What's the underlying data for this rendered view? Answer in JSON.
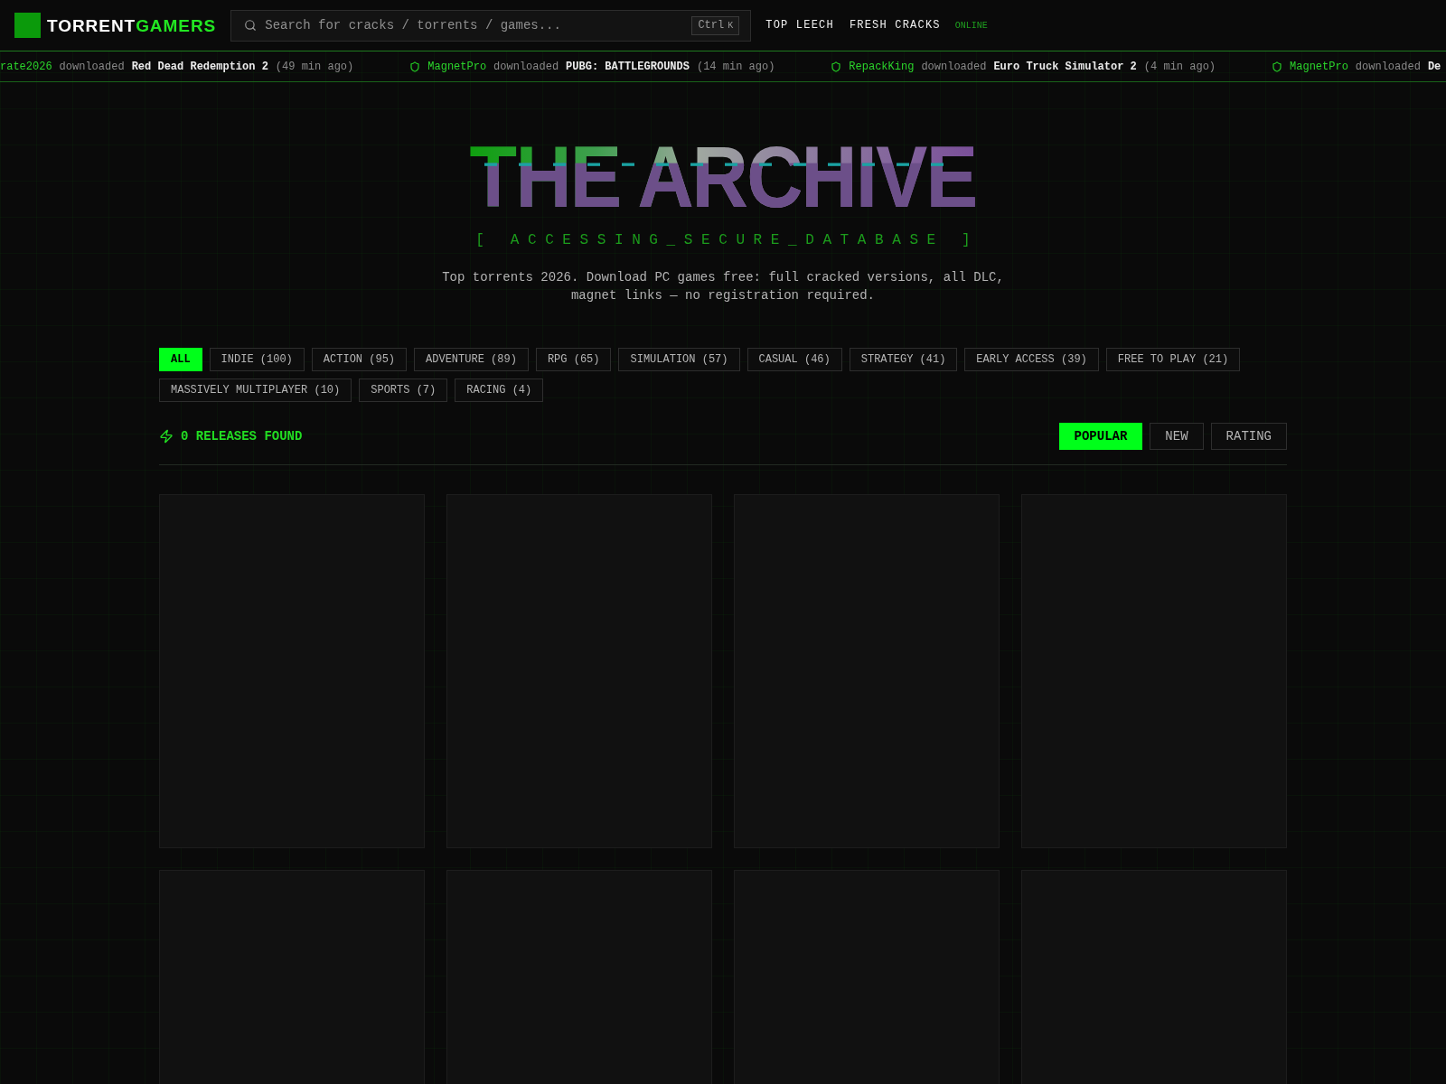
{
  "header": {
    "logo": {
      "name_main": "TORRENT",
      "name_accent": "GAMERS"
    },
    "search": {
      "placeholder": "Search for cracks / torrents / games...",
      "shortcut": {
        "modifier": "Ctrl",
        "key": "K"
      }
    },
    "nav": [
      {
        "label": "TOP LEECH"
      },
      {
        "label": "FRESH CRACKS"
      }
    ],
    "status": "ONLINE"
  },
  "ticker": [
    {
      "shield": false,
      "user": "rate2026",
      "verb": "downloaded",
      "game": "Red Dead Redemption 2",
      "time": "(49 min ago)"
    },
    {
      "shield": true,
      "user": "MagnetPro",
      "verb": "downloaded",
      "game": "PUBG: BATTLEGROUNDS",
      "time": "(14 min ago)"
    },
    {
      "shield": true,
      "user": "RepackKing",
      "verb": "downloaded",
      "game": "Euro Truck Simulator 2",
      "time": "(4 min ago)"
    },
    {
      "shield": true,
      "user": "MagnetPro",
      "verb": "downloaded",
      "game": "De"
    }
  ],
  "hero": {
    "title": "THE ARCHIVE",
    "subtitle": "[ ACCESSING_SECURE_DATABASE ]",
    "description": "Top torrents 2026. Download PC games free: full cracked versions, all DLC, magnet links — no registration required."
  },
  "categories": [
    {
      "label": "ALL",
      "selected": true
    },
    {
      "label": "INDIE (100)",
      "selected": false
    },
    {
      "label": "ACTION (95)",
      "selected": false
    },
    {
      "label": "ADVENTURE (89)",
      "selected": false
    },
    {
      "label": "RPG (65)",
      "selected": false
    },
    {
      "label": "SIMULATION (57)",
      "selected": false
    },
    {
      "label": "CASUAL (46)",
      "selected": false
    },
    {
      "label": "STRATEGY (41)",
      "selected": false
    },
    {
      "label": "EARLY ACCESS (39)",
      "selected": false
    },
    {
      "label": "FREE TO PLAY (21)",
      "selected": false
    },
    {
      "label": "MASSIVELY MULTIPLAYER (10)",
      "selected": false
    },
    {
      "label": "SPORTS (7)",
      "selected": false
    },
    {
      "label": "RACING (4)",
      "selected": false
    }
  ],
  "results": {
    "count_label": "0 RELEASES FOUND"
  },
  "sort": [
    {
      "label": "POPULAR",
      "selected": true
    },
    {
      "label": "NEW",
      "selected": false
    },
    {
      "label": "RATING",
      "selected": false
    }
  ],
  "cards": [
    {
      "kind": "skeleton"
    },
    {
      "kind": "skeleton"
    },
    {
      "kind": "skeleton"
    },
    {
      "kind": "skeleton"
    },
    {
      "kind": "skeleton"
    },
    {
      "kind": "skeleton"
    },
    {
      "kind": "skeleton"
    },
    {
      "kind": "skeleton"
    }
  ]
}
